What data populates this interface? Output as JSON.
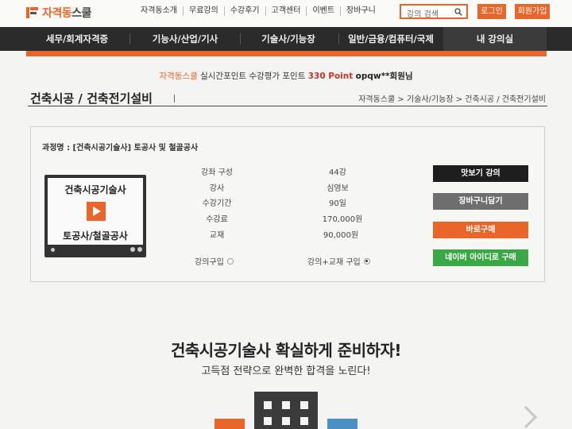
{
  "header": {
    "logo_text_a": "자격동",
    "logo_text_b": "스쿨",
    "nav": [
      "자격동소개",
      "무료강의",
      "수강후기",
      "고객센터",
      "이벤트",
      "장바구니"
    ],
    "search_placeholder": "강의 검색",
    "login_label": "로그인",
    "join_label": "회원가입"
  },
  "main_nav": {
    "items": [
      "세무/회계자격증",
      "기능사/산업/기사",
      "기술사/기능장",
      "일반/금융/컴퓨터/국제",
      "내 강의실"
    ]
  },
  "ticker": {
    "brand": "자격동스쿨",
    "text_a": "실시간포인트 수강평가 포인트",
    "points": "330 Point",
    "user": "opqw**회원님"
  },
  "page": {
    "title": "건축시공 / 건축전기설비",
    "breadcrumb": "자격동스쿨 > 기술사/기능장 > 건축시공 / 건축전기설비"
  },
  "course": {
    "name": "과정명 : [건축시공기술사] 토공사 및 철골공사",
    "thumb_title": "건축시공기술사",
    "thumb_sub": "토공사/철골공사",
    "info": [
      {
        "label": "강좌 구성",
        "value": "44강"
      },
      {
        "label": "강사",
        "value": "심영보"
      },
      {
        "label": "수강기간",
        "value": "90일"
      },
      {
        "label": "수강료",
        "value": "170,000원"
      },
      {
        "label": "교재",
        "value": "90,000원"
      }
    ],
    "option_lecture": "강의구입",
    "option_bundle": "강의+교재 구입",
    "selected_option": "강의+교재 구입",
    "actions": {
      "preview": "맛보기 강의",
      "cart": "장바구니담기",
      "buy": "바로구매",
      "naver": "네이버 아이디로 구매"
    }
  },
  "promo": {
    "title": "건축시공기술사 확실하게 준비하자!",
    "subtitle": "고득점 전략으로 완벽한 합격을 노린다!"
  },
  "colors": {
    "accent": "#e8662a",
    "nav_bg": "#2b2b2b",
    "naver": "#3aa844"
  }
}
